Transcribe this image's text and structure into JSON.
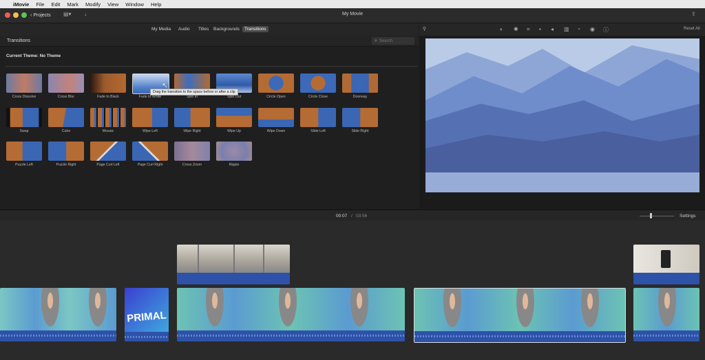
{
  "menubar": {
    "app": "iMovie",
    "items": [
      "File",
      "Edit",
      "Mark",
      "Modify",
      "View",
      "Window",
      "Help"
    ]
  },
  "titlebar": {
    "projects_label": "Projects",
    "title": "My Movie"
  },
  "browser_tabs": {
    "items": [
      "My Media",
      "Audio",
      "Titles",
      "Backgrounds",
      "Transitions"
    ],
    "active": "Transitions"
  },
  "viewer": {
    "reset_label": "Reset All"
  },
  "transitions": {
    "header": "Transitions",
    "search_placeholder": "Search",
    "theme": "Current Theme: No Theme",
    "tooltip": "Drag the transition to the space before or after a clip",
    "items": [
      "Cross Dissolve",
      "Cross Blur",
      "Fade to Black",
      "Fade to White",
      "Spin In",
      "Spin Out",
      "Circle Open",
      "Circle Close",
      "Doorway",
      "Swap",
      "Cube",
      "Mosaic",
      "Wipe Left",
      "Wipe Right",
      "Wipe Up",
      "Wipe Down",
      "Slide Left",
      "Slide Right",
      "Puzzle Left",
      "Puzzle Right",
      "Page Curl Left",
      "Page Curl Right",
      "Cross Zoom",
      "Ripple"
    ]
  },
  "timeline": {
    "current_time": "00:07",
    "separator": "/",
    "total_time": "03:56",
    "settings_label": "Settings",
    "title_clip_text": "PRIMAL"
  },
  "colors": {
    "accent_blue": "#2d52a8",
    "menubar_bg": "#e9e9e9",
    "panel_bg": "#1f1f1f"
  }
}
